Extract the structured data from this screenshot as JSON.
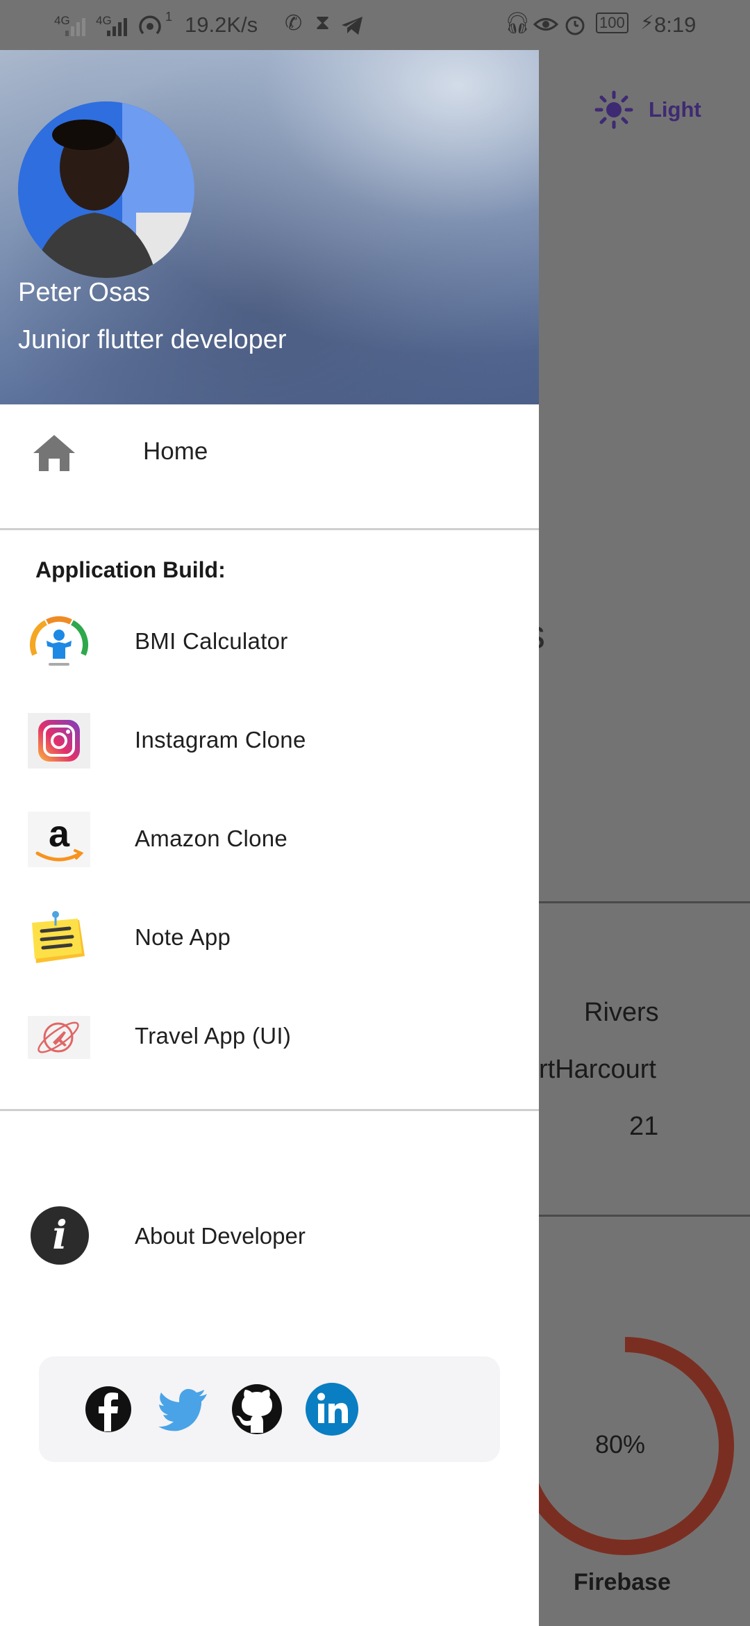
{
  "status_bar": {
    "net_left": "4G",
    "net_right": "4G",
    "hotspot_count": "1",
    "speed": "19.2K/s",
    "battery": "100",
    "time": "8:19"
  },
  "background": {
    "theme_toggle_label": "Light",
    "state": "Rivers",
    "city": "rtHarcourt",
    "age": "21",
    "partial_heading": "s",
    "partial_heading_2": ")",
    "skill_percent": "80%",
    "skill_name": "Firebase",
    "accent_color": "#3e2a73",
    "ring_color": "#7a2e21"
  },
  "drawer": {
    "profile": {
      "name": "Peter Osas",
      "role": "Junior flutter developer"
    },
    "home_label": "Home",
    "section_title": "Application Build:",
    "apps": [
      {
        "label": "BMI Calculator",
        "icon": "bmi-icon"
      },
      {
        "label": "Instagram Clone",
        "icon": "instagram-icon"
      },
      {
        "label": "Amazon Clone",
        "icon": "amazon-icon"
      },
      {
        "label": "Note App",
        "icon": "note-icon"
      },
      {
        "label": "Travel App (UI)",
        "icon": "travel-icon"
      }
    ],
    "about_label": "About Developer",
    "socials": [
      "facebook-icon",
      "twitter-icon",
      "github-icon",
      "linkedin-icon"
    ]
  }
}
